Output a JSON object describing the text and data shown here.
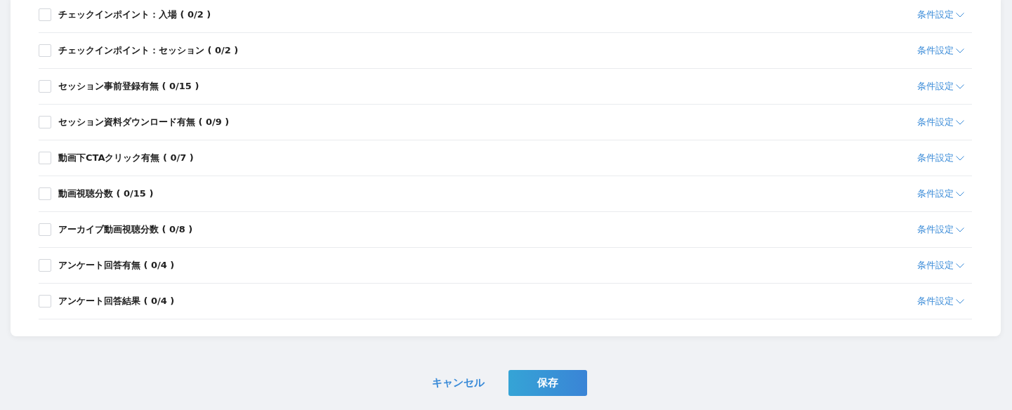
{
  "conditions": [
    {
      "label": "チェックインポイント：入場 ( 0/2 )",
      "checked": false,
      "action": "条件設定"
    },
    {
      "label": "チェックインポイント：セッション ( 0/2 )",
      "checked": false,
      "action": "条件設定"
    },
    {
      "label": "セッション事前登録有無 ( 0/15 )",
      "checked": false,
      "action": "条件設定"
    },
    {
      "label": "セッション資料ダウンロード有無 ( 0/9 )",
      "checked": false,
      "action": "条件設定"
    },
    {
      "label": "動画下CTAクリック有無 ( 0/7 )",
      "checked": false,
      "action": "条件設定"
    },
    {
      "label": "動画視聴分数 ( 0/15 )",
      "checked": false,
      "action": "条件設定"
    },
    {
      "label": "アーカイブ動画視聴分数 ( 0/8 )",
      "checked": false,
      "action": "条件設定"
    },
    {
      "label": "アンケート回答有無 ( 0/4 )",
      "checked": false,
      "action": "条件設定"
    },
    {
      "label": "アンケート回答結果 ( 0/4 )",
      "checked": false,
      "action": "条件設定"
    }
  ],
  "footer": {
    "cancel": "キャンセル",
    "save": "保存"
  }
}
